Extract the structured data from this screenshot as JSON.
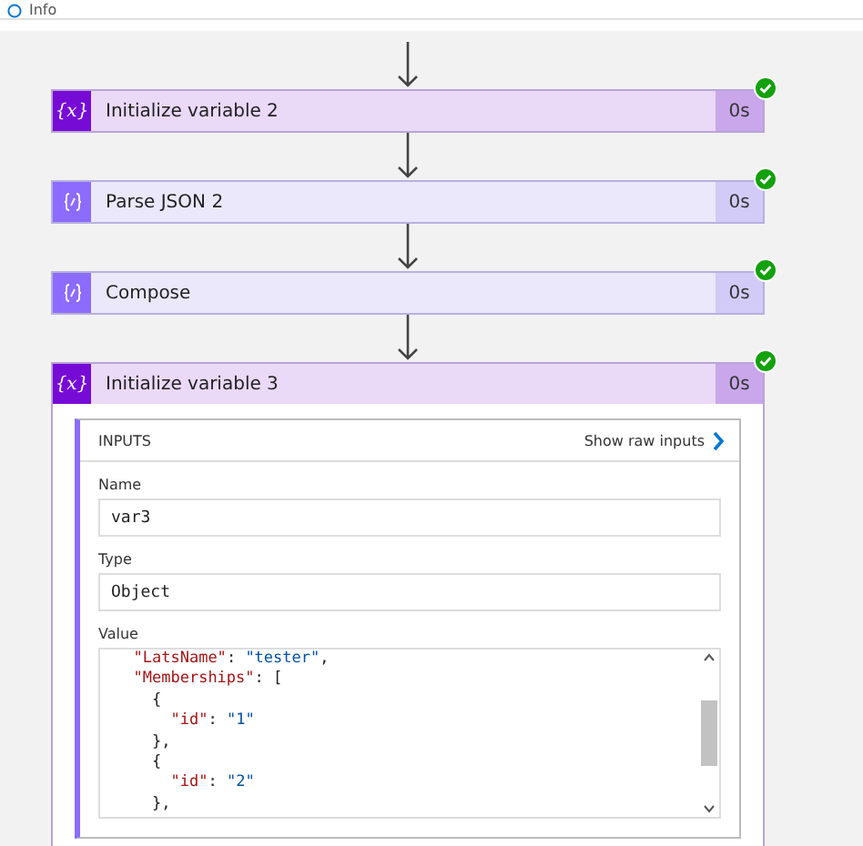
{
  "header": {
    "label": "Info"
  },
  "steps": [
    {
      "kind": "variable",
      "icon": "{x}",
      "title": "Initialize variable 2",
      "duration": "0s",
      "succeeded": true,
      "expanded": false
    },
    {
      "kind": "data",
      "title": "Parse JSON 2",
      "duration": "0s",
      "succeeded": true,
      "expanded": false
    },
    {
      "kind": "data",
      "title": "Compose",
      "duration": "0s",
      "succeeded": true,
      "expanded": false
    },
    {
      "kind": "variable",
      "icon": "{x}",
      "title": "Initialize variable 3",
      "duration": "0s",
      "succeeded": true,
      "expanded": true,
      "inputs": {
        "heading": "INPUTS",
        "raw_link": "Show raw inputs",
        "fields": [
          {
            "label": "Name",
            "value": "var3"
          },
          {
            "label": "Type",
            "value": "Object"
          }
        ],
        "value_label": "Value",
        "code_lines": [
          "  \"LatsName\": \"tester\",",
          "  \"Memberships\": [",
          "    {",
          "      \"id\": \"1\"",
          "    },",
          "    {",
          "      \"id\": \"2\"",
          "    },"
        ]
      }
    }
  ]
}
